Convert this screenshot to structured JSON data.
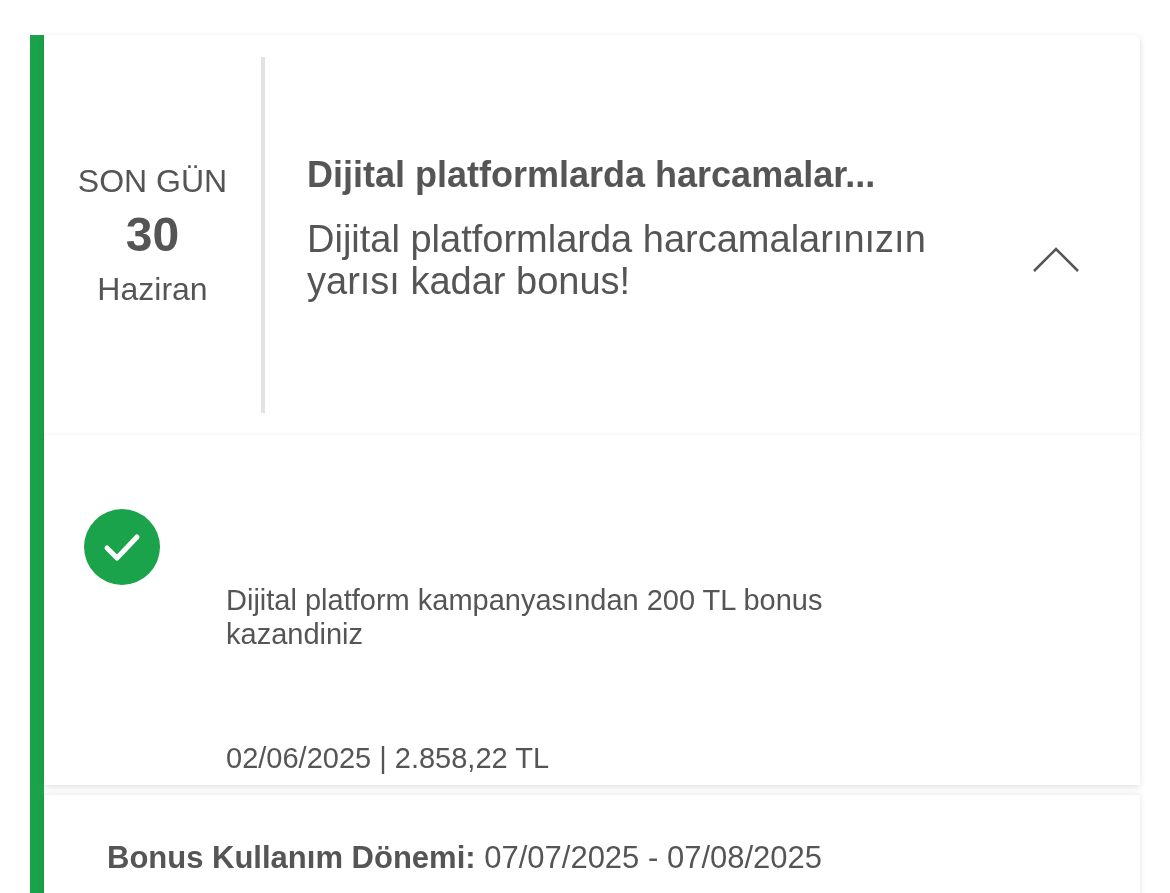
{
  "deadline": {
    "label": "SON GÜN",
    "day": "30",
    "month": "Haziran"
  },
  "campaign": {
    "title": "Dijital platformlarda harcamalar...",
    "description": "Dijital platformlarda harcamalarınızın yarısı kadar bonus!",
    "expanded": true
  },
  "result": {
    "earned": true,
    "message": "Dijital platform kampanyasından 200 TL bonus kazandiniz",
    "meta": "02/06/2025 | 2.858,22 TL"
  },
  "bonus_period": {
    "label": "Bonus Kullanım Dönemi:",
    "value": "07/07/2025 - 07/08/2025"
  }
}
